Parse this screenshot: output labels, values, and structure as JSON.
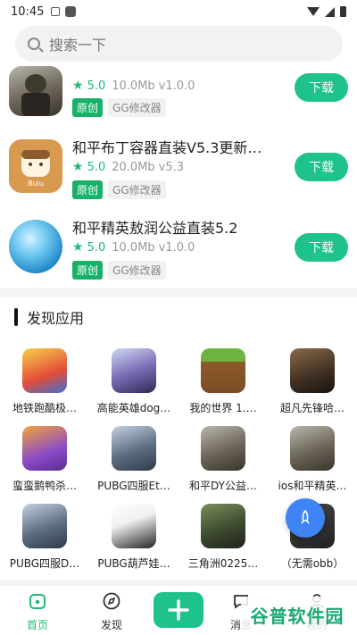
{
  "status_bar": {
    "time": "10:45"
  },
  "search": {
    "placeholder": "搜索一下"
  },
  "apps": [
    {
      "title": "",
      "rating": "5.0",
      "size": "10.0Mb",
      "version": "v1.0.0",
      "tag_original": "原创",
      "tag_category": "GG修改器",
      "download": "下载"
    },
    {
      "title": "和平布丁容器直装V5.3更新…",
      "rating": "5.0",
      "size": "20.0Mb",
      "version": "v5.3",
      "tag_original": "原创",
      "tag_category": "GG修改器",
      "download": "下载"
    },
    {
      "title": "和平精英敖润公益直装5.2",
      "rating": "5.0",
      "size": "10.0Mb",
      "version": "v1.0.0",
      "tag_original": "原创",
      "tag_category": "GG修改器",
      "download": "下载"
    }
  ],
  "discover": {
    "title": "发现应用",
    "items": [
      {
        "label": "地铁跑酷极…"
      },
      {
        "label": "高能英雄dog…"
      },
      {
        "label": "我的世界 1.…"
      },
      {
        "label": "超凡先锋哈…"
      },
      {
        "label": "蛮蛮鹅鸭杀…"
      },
      {
        "label": "PUBG四服Et…"
      },
      {
        "label": "和平DY公益…"
      },
      {
        "label": "ios和平精英…"
      },
      {
        "label": "PUBG四服D…"
      },
      {
        "label": "PUBG葫芦娃…"
      },
      {
        "label": "三角洲0225…"
      },
      {
        "label": "（无需obb）"
      }
    ]
  },
  "nav": {
    "home": "首页",
    "discover": "发现",
    "messages": "消息",
    "mine": "我的"
  },
  "watermark": "谷普软件园",
  "colors": {
    "accent": "#1dc38a",
    "fab": "#3e84f5"
  }
}
